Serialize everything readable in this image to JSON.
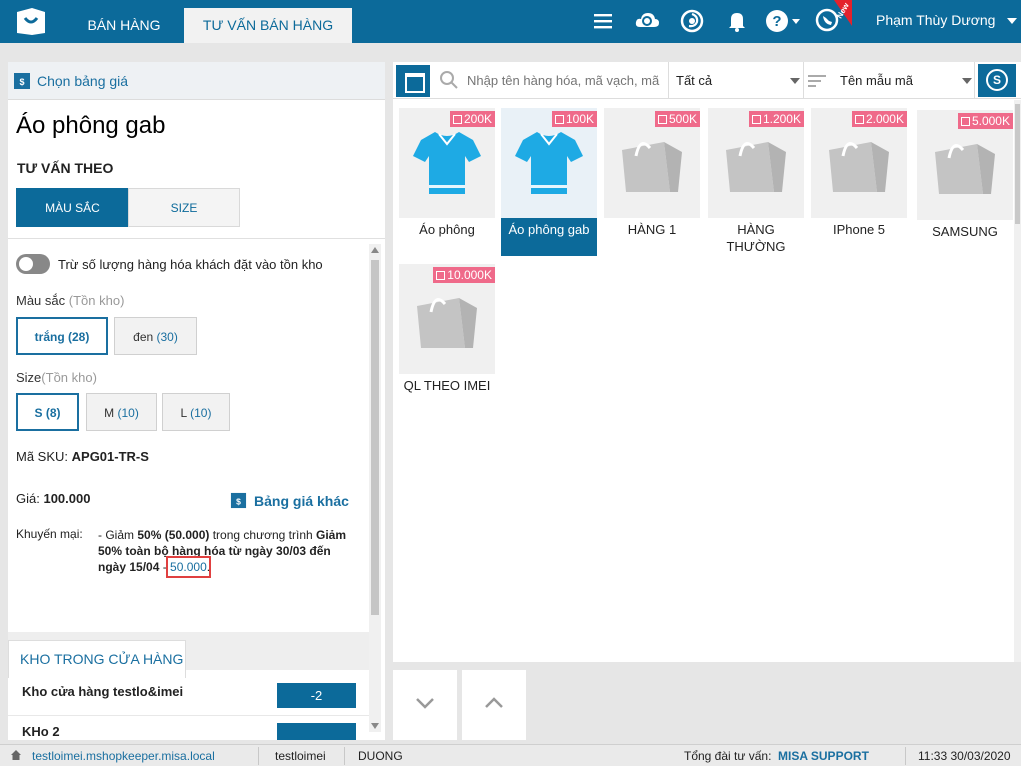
{
  "topbar": {
    "tabs": [
      {
        "label": "BÁN HÀNG"
      },
      {
        "label": "TƯ VẤN BÁN HÀNG"
      }
    ],
    "new_badge": "New",
    "user_name": "Phạm Thùy Dương"
  },
  "left": {
    "price_list_link": "Chọn bảng giá",
    "product_name": "Áo phông gab",
    "advise_title": "TƯ VẤN THEO",
    "segments": [
      "MÀU SẮC",
      "SIZE"
    ],
    "toggle_label": "Trừ số lượng hàng hóa khách đặt vào tồn kho",
    "color_label": "Màu sắc",
    "size_label": "Size",
    "stock_hint": "(Tồn kho)",
    "colors": [
      {
        "name": "trắng",
        "count": "(28)"
      },
      {
        "name": "đen",
        "count": "(30)"
      }
    ],
    "sizes": [
      {
        "name": "S",
        "count": "(8)"
      },
      {
        "name": "M",
        "count": "(10)"
      },
      {
        "name": "L",
        "count": "(10)"
      }
    ],
    "sku_label": "Mã SKU:",
    "sku_value": "APG01-TR-S",
    "price_label": "Giá:",
    "price_value": "100.000",
    "other_price": "Bảng giá khác",
    "promo_label": "Khuyến mại:",
    "promo": {
      "p1": "- Giảm ",
      "pct": "50% (50.000)",
      "p2": " trong chương trình ",
      "program": "Giảm 50% toàn bộ hàng hóa từ ngày 30/03 đến ngày 15/04",
      "dash": " - ",
      "amount": "50.000",
      "end": "."
    },
    "stock_tab": "KHO TRONG CỬA HÀNG",
    "warehouses": [
      {
        "name": "Kho cửa hàng testlo&imei",
        "qty": "-2"
      },
      {
        "name": "KHo 2",
        "qty": ""
      }
    ]
  },
  "right": {
    "search_placeholder": "Nhập tên hàng hóa, mã vạch, mã",
    "category": "Tất cả",
    "sort": "Tên mẫu mã",
    "s_button": "S",
    "products": [
      {
        "name": "Áo phông",
        "badge": "200K",
        "icon": "polo-shirt"
      },
      {
        "name": "Áo phông gab",
        "badge": "100K",
        "icon": "polo-shirt"
      },
      {
        "name": "HÀNG 1",
        "badge": "500K",
        "icon": "shopping-bag"
      },
      {
        "name": "HÀNG THƯỜNG",
        "badge": "1.200K",
        "icon": "shopping-bag"
      },
      {
        "name": "IPhone 5",
        "badge": "2.000K",
        "icon": "shopping-bag"
      },
      {
        "name": "SAMSUNG",
        "badge": "5.000K",
        "icon": "shopping-bag"
      },
      {
        "name": "QL THEO IMEI",
        "badge": "10.000K",
        "icon": "shopping-bag"
      }
    ]
  },
  "statusbar": {
    "url": "testloimei.mshopkeeper.misa.local",
    "shop": "testloimei",
    "user": "DUONG",
    "hotline_label": "Tổng đài tư vấn:",
    "hotline_value": "MISA SUPPORT",
    "datetime": "11:33 30/03/2020"
  },
  "colors": {
    "primary": "#0c6a9a",
    "badge": "#ef6a8a",
    "highlight": "#e04040"
  }
}
